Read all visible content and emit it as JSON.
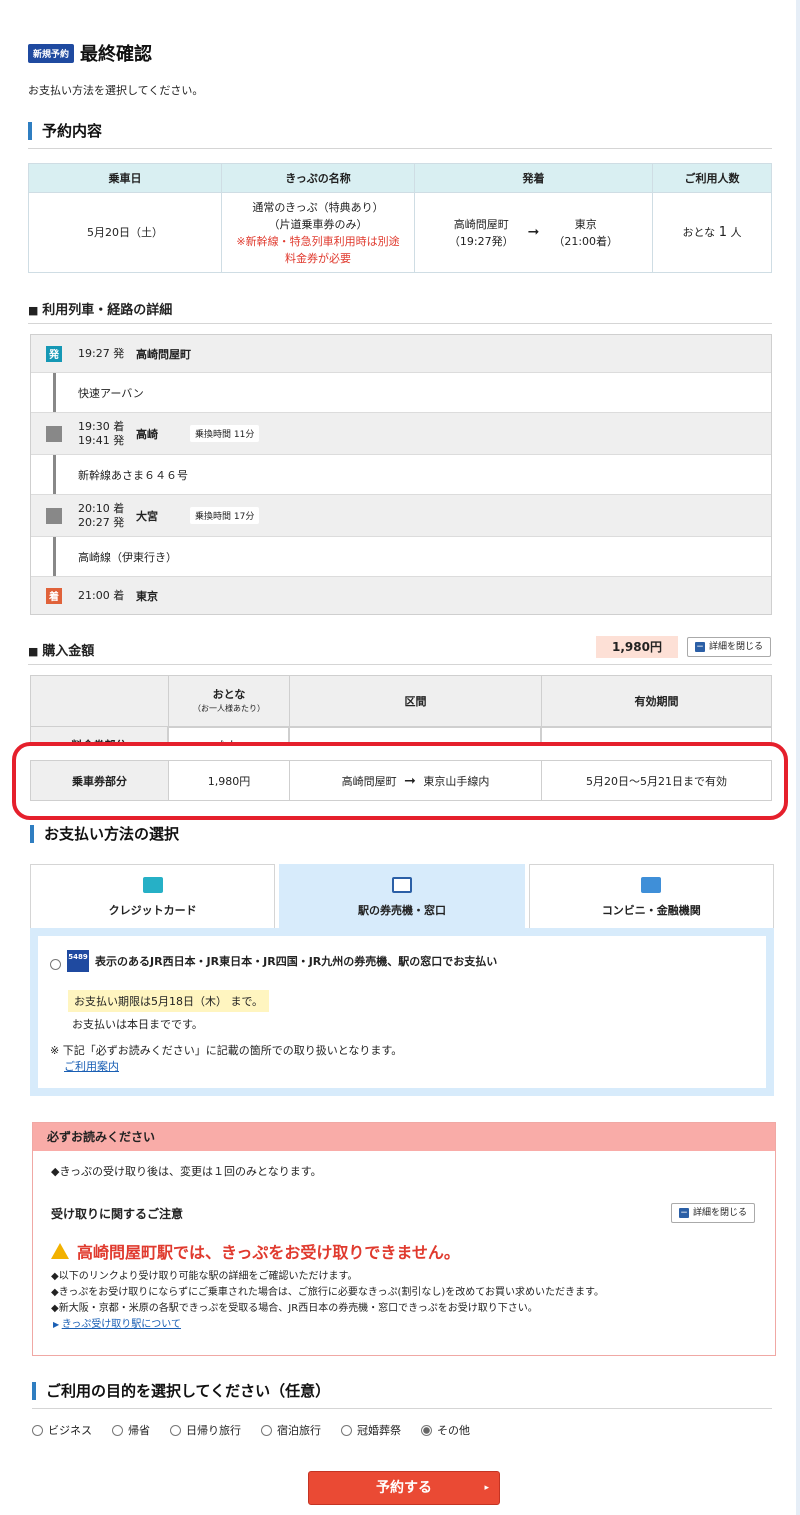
{
  "header": {
    "badge": "新規予約",
    "title": "最終確認",
    "intro": "お支払い方法を選択してください。"
  },
  "reservation": {
    "title": "予約内容",
    "columns": [
      "乗車日",
      "きっぷの名称",
      "発着",
      "ご利用人数"
    ],
    "date": "5月20日（土）",
    "ticket_line1": "通常のきっぷ（特典あり）",
    "ticket_line2": "（片道乗車券のみ）",
    "ticket_note1": "※新幹線・特急列車利用時は別途",
    "ticket_note2": "料金券が必要",
    "from_station": "高崎問屋町",
    "from_time": "（19:27発）",
    "to_station": "東京",
    "to_time": "（21:00着）",
    "arrow": "➞",
    "people_label": "おとな",
    "people_count": "1",
    "people_unit": "人"
  },
  "route": {
    "title": "利用列車・経路の詳細",
    "dep_mark": "発",
    "arr_mark": "着",
    "stops": [
      {
        "time": "19:27 発",
        "station": "高崎問屋町"
      },
      {
        "train": "快速アーバン"
      },
      {
        "time1": "19:30 着",
        "time2": "19:41 発",
        "station": "高崎",
        "transfer": "乗換時間 11分"
      },
      {
        "train": "新幹線あさま６４６号"
      },
      {
        "time1": "20:10 着",
        "time2": "20:27 発",
        "station": "大宮",
        "transfer": "乗換時間 17分"
      },
      {
        "train": "高崎線（伊東行き）"
      },
      {
        "time": "21:00 着",
        "station": "東京"
      }
    ]
  },
  "purchase": {
    "title": "購入金額",
    "total": "1,980円",
    "close_label": "詳細を閉じる",
    "col_adult": "おとな",
    "col_adult_sub": "（お一人様あたり）",
    "col_section": "区間",
    "col_valid": "有効期間",
    "row_fee_label": "料金券部分",
    "row_fee_value": "なし",
    "row_ticket_label": "乗車券部分",
    "row_ticket_price": "1,980円",
    "row_ticket_from": "高崎問屋町",
    "row_ticket_to": "東京山手線内",
    "row_ticket_valid": "5月20日～5月21日まで有効"
  },
  "payment": {
    "title": "お支払い方法の選択",
    "tabs": [
      "クレジットカード",
      "駅の券売機・窓口",
      "コンビニ・金融機関"
    ],
    "suica_text": "5489",
    "option_label": "表示のあるJR西日本・JR東日本・JR四国・JR九州の券売機、駅の窓口でお支払い",
    "deadline": "お支払い期限は5月18日（木） まで。",
    "today_note": "お支払いは本日までです。",
    "remark": "※ 下記「必ずお読みください」に記載の箇所での取り扱いとなります。",
    "guide_link": "ご利用案内"
  },
  "notice": {
    "title": "必ずお読みください",
    "line1": "◆きっぷの受け取り後は、変更は１回のみとなります。",
    "sub_title": "受け取りに関するご注意",
    "close_label": "詳細を閉じる",
    "warning": "高崎問屋町駅では、きっぷをお受け取りできません。",
    "b1": "◆以下のリンクより受け取り可能な駅の詳細をご確認いただけます。",
    "b2": "◆きっぷをお受け取りにならずにご乗車された場合は、ご旅行に必要なきっぷ(割引なし)を改めてお買い求めいただきます。",
    "b3": "◆新大阪・京都・米原の各駅できっぷを受取る場合、JR西日本の券売機・窓口できっぷをお受け取り下さい。",
    "link": "きっぷ受け取り駅について"
  },
  "purpose": {
    "title": "ご利用の目的を選択してください（任意）",
    "options": [
      "ビジネス",
      "帰省",
      "日帰り旅行",
      "宿泊旅行",
      "冠婚葬祭",
      "その他"
    ],
    "selected": "その他"
  },
  "submit_label": "予約する",
  "colors": {
    "accent": "#2f7ec1",
    "submit": "#ea4a34",
    "warning": "#e03a2e",
    "highlight_ring": "#e5202c"
  }
}
